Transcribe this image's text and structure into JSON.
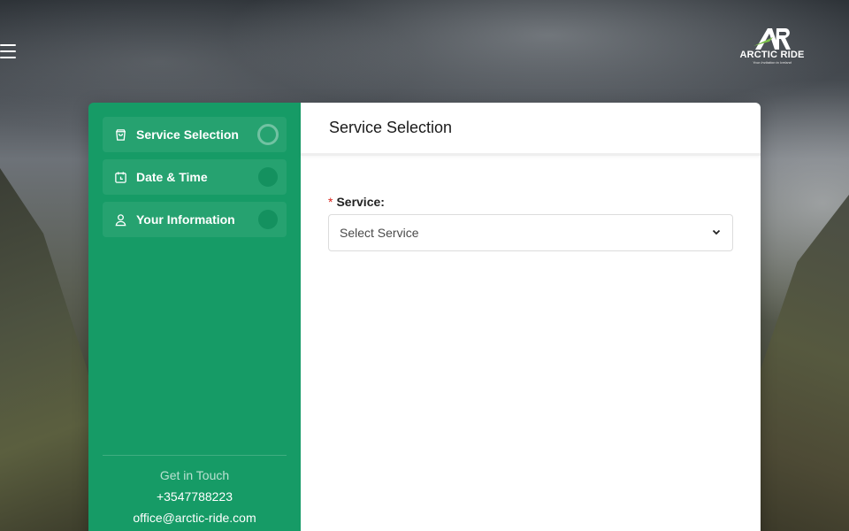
{
  "brand": {
    "name": "ARCTIC RIDE",
    "tagline": "Your Invitation to Iceland",
    "accent_color": "#169b66"
  },
  "nav": {
    "menu_icon": "hamburger-icon"
  },
  "sidebar": {
    "steps": [
      {
        "label": "Service Selection",
        "icon": "shopping-bag-icon",
        "active": true
      },
      {
        "label": "Date & Time",
        "icon": "calendar-icon",
        "active": false
      },
      {
        "label": "Your Information",
        "icon": "user-icon",
        "active": false
      }
    ],
    "contact": {
      "title": "Get in Touch",
      "phone": "+3547788223",
      "email": "office@arctic-ride.com"
    }
  },
  "main": {
    "title": "Service Selection",
    "service_field": {
      "required_mark": "*",
      "label": "Service:",
      "selected": "Select Service"
    }
  }
}
